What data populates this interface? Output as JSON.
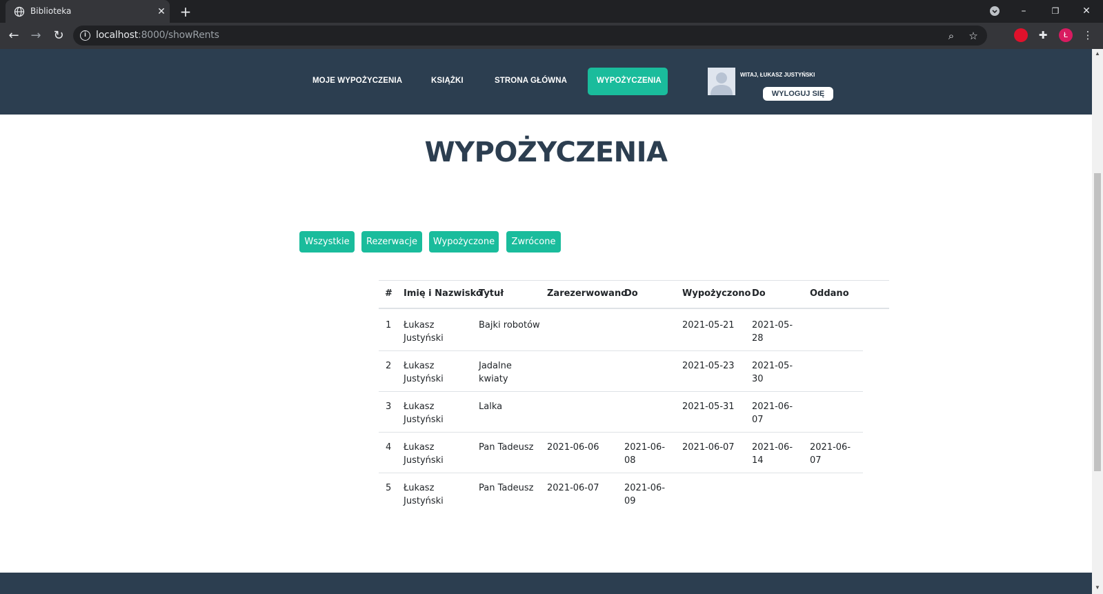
{
  "browser": {
    "tab_title": "Biblioteka",
    "url_host": "localhost",
    "url_path": ":8000/showRents",
    "profile_initial": "Ł"
  },
  "nav": {
    "items": [
      "MOJE WYPOŻYCZENIA",
      "KSIĄŻKI",
      "STRONA GŁÓWNA",
      "WYPOŻYCZENIA"
    ],
    "active": "WYPOŻYCZENIA",
    "greeting": "WITAJ, ŁUKASZ JUSTYŃSKI",
    "logout": "WYLOGUJ SIĘ"
  },
  "page": {
    "title": "WYPOŻYCZENIA"
  },
  "filters": [
    "Wszystkie",
    "Rezerwacje",
    "Wypożyczone",
    "Zwrócone"
  ],
  "table": {
    "headers": [
      "#",
      "Imię i Nazwisko",
      "Tytuł",
      "Zarezerwowano",
      "Do",
      "Wypożyczono",
      "Do",
      "Oddano"
    ],
    "rows": [
      [
        "1",
        "Łukasz",
        "Justyński",
        "Bajki robotów",
        "",
        "",
        "",
        "",
        "2021-05-21",
        "2021-05-",
        "28",
        "",
        ""
      ],
      [
        "2",
        "Łukasz",
        "Justyński",
        "Jadalne",
        "kwiaty",
        "",
        "",
        "",
        "2021-05-23",
        "2021-05-",
        "30",
        "",
        ""
      ],
      [
        "3",
        "Łukasz",
        "Justyński",
        "Lalka",
        "",
        "",
        "",
        "",
        "2021-05-31",
        "2021-06-",
        "07",
        "",
        ""
      ],
      [
        "4",
        "Łukasz",
        "Justyński",
        "Pan Tadeusz",
        "",
        "2021-06-06",
        "2021-06-",
        "08",
        "2021-06-07",
        "2021-06-",
        "14",
        "2021-06-",
        "07"
      ],
      [
        "5",
        "Łukasz",
        "Justyński",
        "Pan Tadeusz",
        "",
        "2021-06-07",
        "2021-06-",
        "09",
        "",
        "",
        "",
        "",
        ""
      ]
    ]
  },
  "colors": {
    "header_bg": "#2c3e50",
    "accent": "#1abc9c"
  }
}
